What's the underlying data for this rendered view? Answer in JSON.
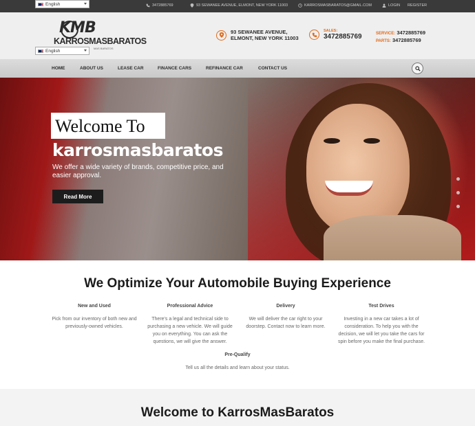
{
  "topbar": {
    "language_top": "English",
    "phone": "3472885769",
    "address": "93 SEWANEE AVENUE, ELMONT, NEW YORK 11003",
    "email": "KARROSMASBARATOS@GMAIL.COM",
    "login": "LOGIN",
    "register": "REGISTER"
  },
  "header": {
    "language": "English",
    "logo_initials": "KMB",
    "logo_name": "KARROSMASBARATOS",
    "logo_tagline": "MAS BARATOS",
    "address_line1": "93 SEWANEE AVENUE,",
    "address_line2": "ELMONT, NEW YORK 11003",
    "sales_label": "SALES:",
    "sales_number": "3472885769",
    "service_label": "SERVICE:",
    "service_number": "3472885769",
    "parts_label": "PARTS:",
    "parts_number": "3472885769"
  },
  "nav": {
    "items": [
      "HOME",
      "ABOUT US",
      "LEASE CAR",
      "FINANCE CARS",
      "REFINANCE CAR",
      "CONTACT US"
    ]
  },
  "hero": {
    "welcome": "Welcome To",
    "brand": "karrosmasbaratos",
    "subtitle": "We offer a wide variety of brands, competitive price, and easier approval.",
    "cta": "Read More"
  },
  "section": {
    "title": "We Optimize Your Automobile Buying Experience",
    "features": [
      {
        "title": "New and Used",
        "desc": "Pick from our inventory of both new and previously-owned vehicles."
      },
      {
        "title": "Professional Advice",
        "desc": "There's a legal and technical side to purchasing a new vehicle. We will guide you on everything. You can ask the questions, we will give the answer."
      },
      {
        "title": "Delivery",
        "desc": "We will deliver the car right to your doorstep. Contact now to learn more."
      },
      {
        "title": "Test Drives",
        "desc": "Investing in a new car takes a lot of consideration. To help you with the decision, we will let you take the cars for spin before you make the final purchase."
      },
      {
        "title": "Pre-Qualify",
        "desc": "Tell us all the details and learn about your status."
      }
    ]
  },
  "bottom": {
    "title": "Welcome to KarrosMasBaratos"
  },
  "colors": {
    "accent": "#e06b1a",
    "topbar": "#3a3a3a",
    "header_bg": "#efefef"
  }
}
